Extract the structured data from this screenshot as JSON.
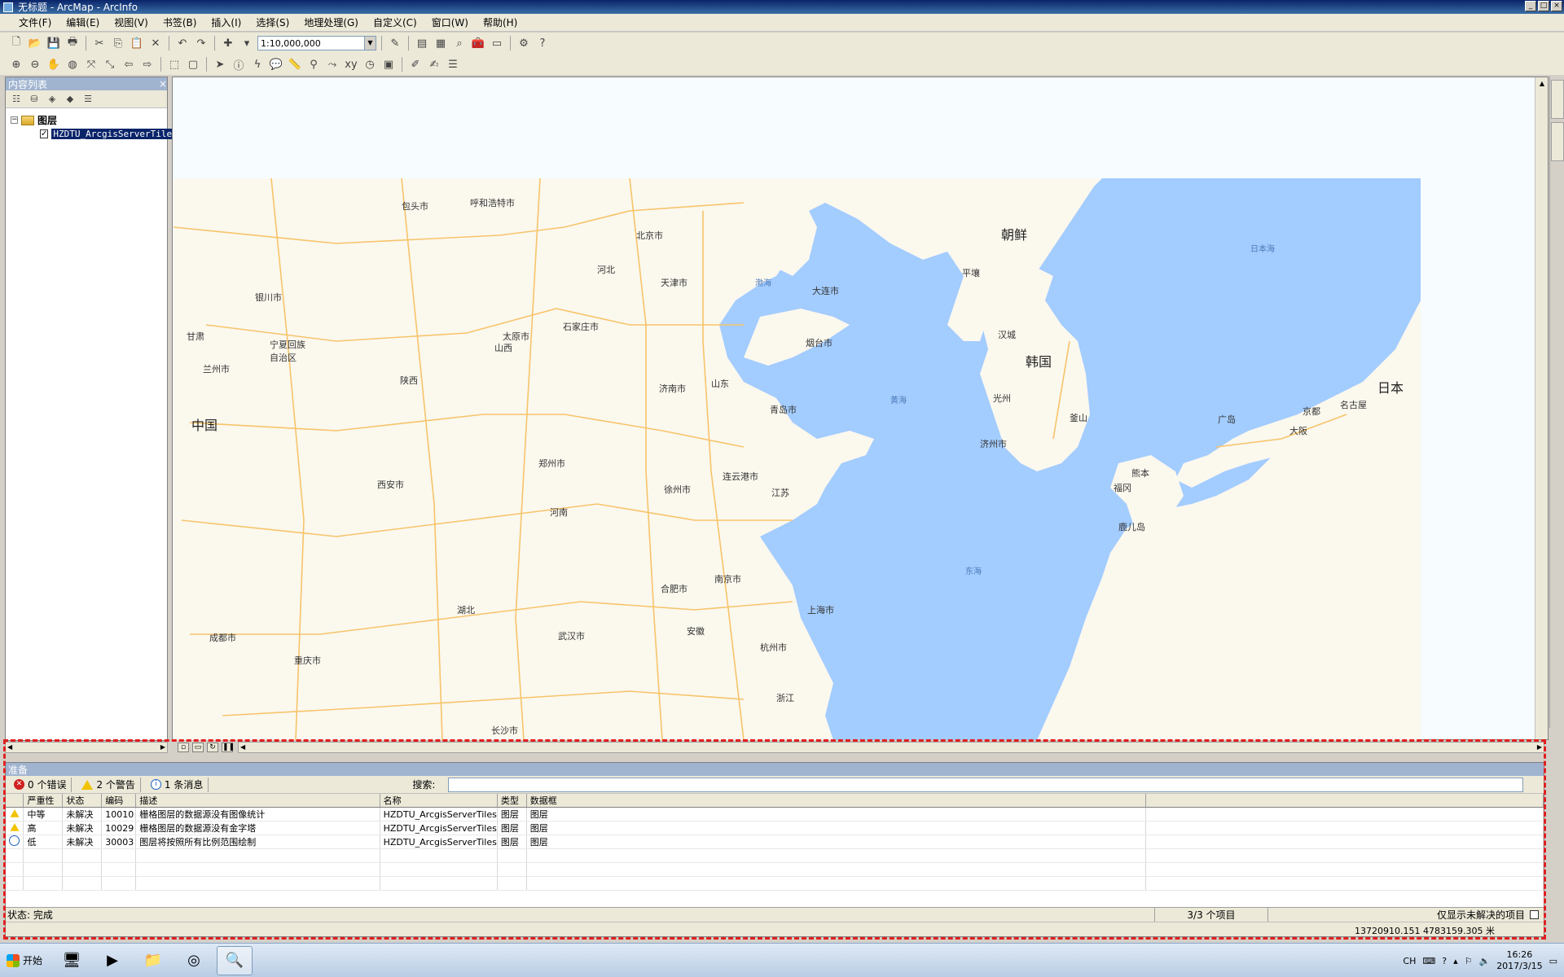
{
  "window": {
    "title": "无标题 - ArcMap - ArcInfo",
    "controls": [
      "_",
      "□",
      "×"
    ]
  },
  "menu": [
    "文件(F)",
    "编辑(E)",
    "视图(V)",
    "书签(B)",
    "插入(I)",
    "选择(S)",
    "地理处理(G)",
    "自定义(C)",
    "窗口(W)",
    "帮助(H)"
  ],
  "toolbar": {
    "scale": "1:10,000,000"
  },
  "toc": {
    "title": "内容列表",
    "root": "图层",
    "layer": "HZDTU_ArcgisServerTile"
  },
  "map": {
    "labels": {
      "china": "中国",
      "korea_n": "朝鲜",
      "korea_s": "韩国",
      "japan": "日本",
      "beijing": "北京市",
      "tianjin": "天津市",
      "shijiazhuang": "石家庄市",
      "taiyuan": "太原市",
      "jinan": "济南市",
      "qingdao": "青岛市",
      "zhengzhou": "郑州市",
      "xian": "西安市",
      "nanjing": "南京市",
      "shanghai": "上海市",
      "hangzhou": "杭州市",
      "wuhan": "武汉市",
      "hefei": "合肥市",
      "dalian": "大连市",
      "yantai": "烟台市",
      "pyongyang": "平壤",
      "seoul": "汉城",
      "busan": "釜山",
      "tokyo_region": "大阪",
      "kyoto": "京都",
      "fukuoka": "福冈",
      "chongqing": "重庆市",
      "chengdu": "成都市",
      "lanzhou": "兰州市",
      "hohhot": "呼和浩特市",
      "baotou": "包头市",
      "yinchuan": "银川市",
      "xuzhou": "徐州市",
      "lianyungang": "连云港市",
      "bohai": "渤海",
      "yellow_sea": "黄海",
      "east_sea": "东海",
      "japan_sea": "日本海",
      "shandong": "山东",
      "henan": "河南",
      "hebei": "河北",
      "shanxi": "山西",
      "shaanxi": "陕西",
      "jiangsu": "江苏",
      "anhui": "安徽",
      "hubei": "湖北",
      "zhejiang": "浙江",
      "ningxia": "宁夏回族\n自治区",
      "gansu": "甘肃",
      "jeju": "济州市",
      "gwangju": "光州",
      "nagoya": "名古屋",
      "hiroshima": "广岛",
      "kumamoto": "熊本",
      "kagoshima": "鹿儿岛",
      "changsha": "长沙市"
    }
  },
  "prepare": {
    "title": "准备",
    "errors": "0 个错误",
    "warnings": "2 个警告",
    "messages": "1 条消息",
    "search_label": "搜索:",
    "columns": [
      "严重性",
      "状态",
      "编码",
      "描述",
      "名称",
      "类型",
      "数据框"
    ],
    "rows": [
      {
        "icon": "warning-icon",
        "severity": "中等",
        "status": "未解决",
        "code": "10010",
        "desc": "栅格图层的数据源没有图像统计",
        "name": "HZDTU_ArcgisServerTiles",
        "type": "图层",
        "frame": "图层"
      },
      {
        "icon": "warning-icon",
        "severity": "高",
        "status": "未解决",
        "code": "10029",
        "desc": "栅格图层的数据源没有金字塔",
        "name": "HZDTU_ArcgisServerTiles",
        "type": "图层",
        "frame": "图层"
      },
      {
        "icon": "info-icon",
        "severity": "低",
        "status": "未解决",
        "code": "30003",
        "desc": "图层将按照所有比例范围绘制",
        "name": "HZDTU_ArcgisServerTiles",
        "type": "图层",
        "frame": "图层"
      }
    ],
    "status": "状态: 完成",
    "count": "3/3 个项目",
    "unresolved_only": "仅显示未解决的项目",
    "coords": "13720910.151  4783159.305 米"
  },
  "taskbar": {
    "start": "开始",
    "lang": "CH",
    "time": "16:26",
    "date": "2017/3/15"
  },
  "colors": {
    "land": "#fbf8ee",
    "sea": "#a3ccff",
    "road": "#f7c46a",
    "title_bar": "#0a246a"
  }
}
